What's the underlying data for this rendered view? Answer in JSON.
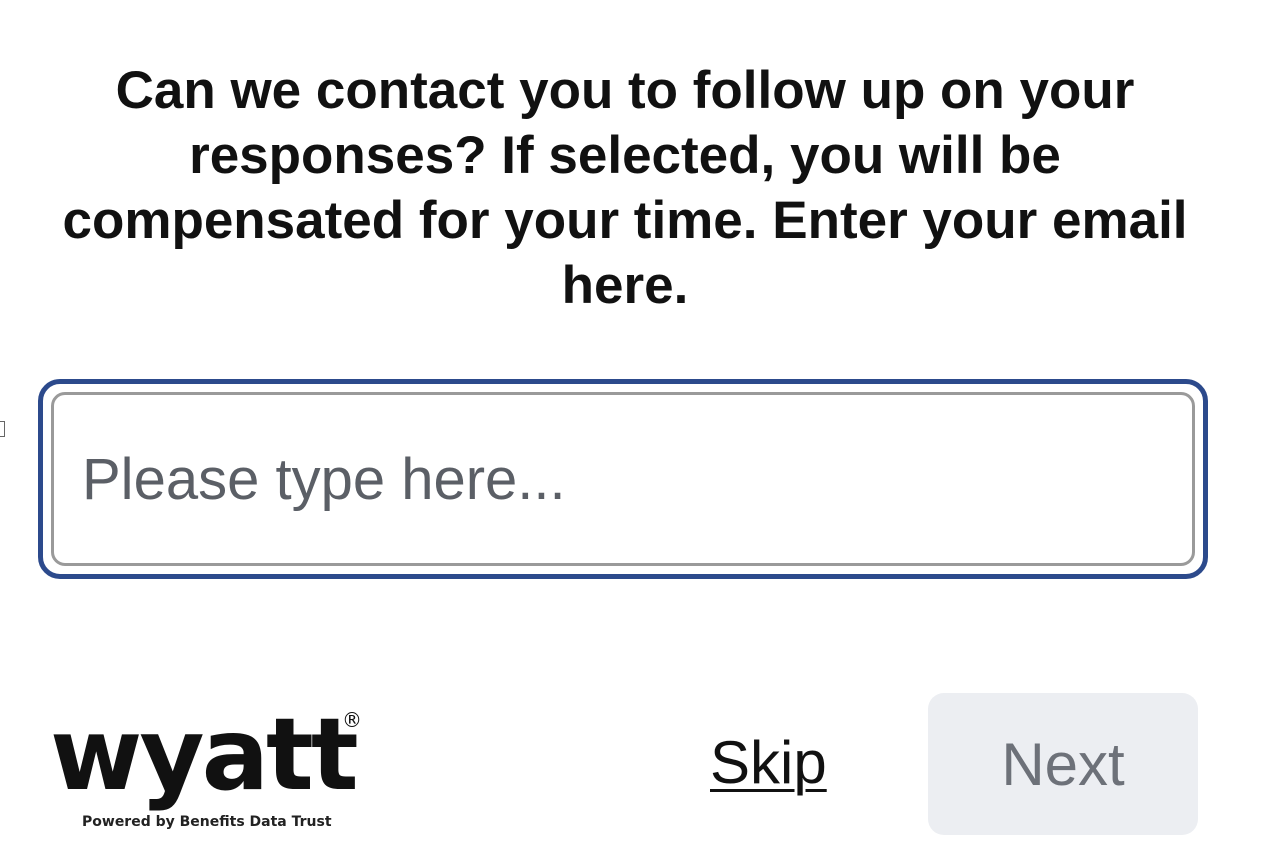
{
  "question": {
    "text": "Can we contact you to follow up on your responses? If selected, you will be compensated for your time. Enter your email here."
  },
  "email_input": {
    "value": "",
    "placeholder": "Please type here..."
  },
  "footer": {
    "logo_text": "wyatt",
    "logo_registered": "®",
    "logo_tagline": "Powered by Benefits Data Trust",
    "skip_label": "Skip",
    "next_label": "Next"
  },
  "colors": {
    "input_focus_border": "#2c4a8c",
    "next_button_bg": "#eceef2",
    "next_button_text": "#6d7179"
  }
}
